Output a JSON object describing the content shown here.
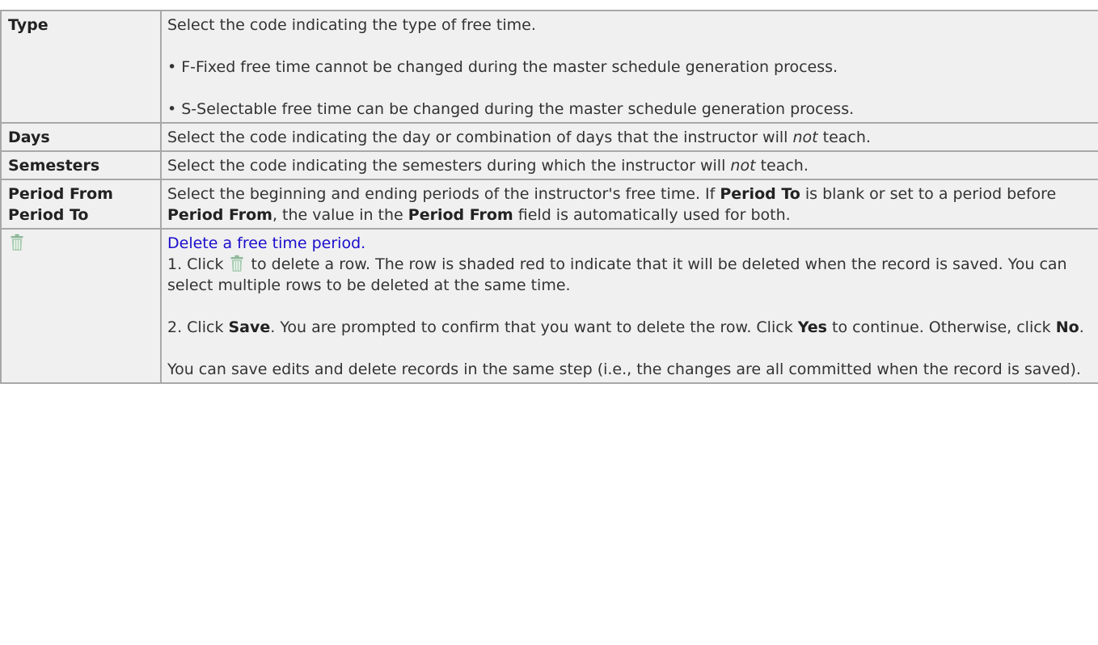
{
  "rows": [
    {
      "term": "Type",
      "desc_intro": "Select the code indicating the type of free time.",
      "bullets": [
        "• F-Fixed free time cannot be changed during the master schedule generation process.",
        "• S-Selectable free time can be changed during the master schedule generation process."
      ]
    },
    {
      "term": "Days",
      "desc_before": "Select the code indicating the day or combination of days that the instructor will ",
      "desc_em": "not",
      "desc_after": " teach."
    },
    {
      "term": "Semesters",
      "desc_before": "Select the code indicating the semesters during which the instructor will ",
      "desc_em": "not",
      "desc_after": " teach."
    },
    {
      "term_lines": [
        "Period From",
        "Period To"
      ],
      "parts": [
        "Select the beginning and ending periods of the instructor's free time. If ",
        "Period To",
        " is blank or set to a period before ",
        "Period From",
        ", the value in the ",
        "Period From",
        " field is automatically used for both."
      ]
    },
    {
      "term_icon": "trash-icon",
      "link_text": "Delete a free time period.",
      "step1_before": "1. Click ",
      "step1_after": " to delete a row. The row is shaded red to indicate that it will be deleted when the record is saved. You can select multiple rows to be deleted at the same time.",
      "step2_parts": [
        "2. Click ",
        "Save",
        ". You are prompted to confirm that you want to delete the row. Click ",
        "Yes",
        " to continue. Otherwise, click ",
        "No",
        "."
      ],
      "note": "You can save edits and delete records in the same step (i.e., the changes are all committed when the record is saved)."
    }
  ],
  "colors": {
    "cell_bg": "#f0f0f0",
    "border": "#a8a8a8",
    "link": "#1a0dcc",
    "icon": "#8fb89a"
  }
}
